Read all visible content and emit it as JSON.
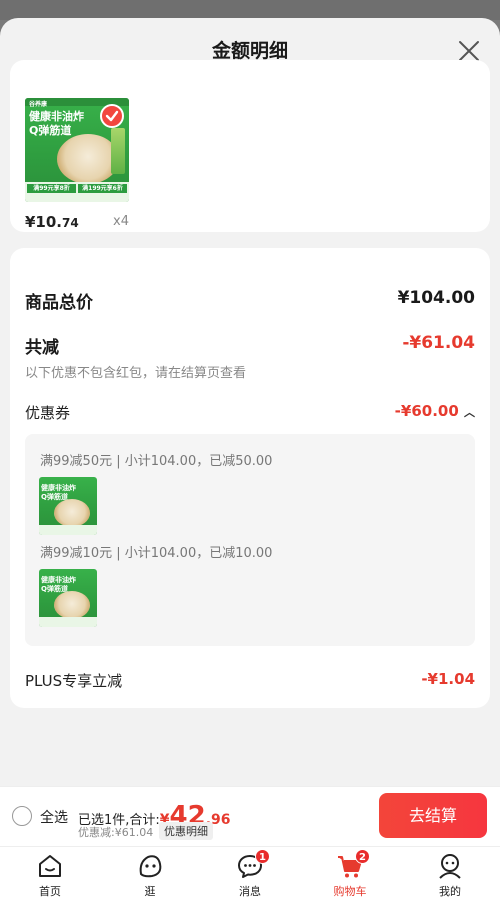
{
  "sheet": {
    "title": "金额明细"
  },
  "item": {
    "price_int": "¥10.",
    "price_dec": "74",
    "qty": "x4",
    "image": {
      "headline1": "健康非油炸",
      "headline2": "Q弹筋道",
      "brand": "谷养康",
      "promo1": "满99元享8折",
      "promo2": "满199元享6折"
    }
  },
  "summary": {
    "total_label": "商品总价",
    "total_value": "¥104.00",
    "discount_label": "共减",
    "discount_value": "-¥61.04",
    "note": "以下优惠不包含红包，请在结算页查看",
    "coupon_label": "优惠券",
    "coupon_value": "-¥60.00",
    "coupon_lines": [
      "满99减50元 | 小计104.00，已减50.00",
      "满99减10元 | 小计104.00，已减10.00"
    ],
    "plus_label": "PLUS专享立减",
    "plus_value": "-¥1.04"
  },
  "checkout": {
    "select_all": "全选",
    "summary_prefix": "已选1件,合计:",
    "total_cur": "¥",
    "total_int": "42",
    "total_dec": ".96",
    "saved": "优惠减:¥61.04",
    "detail_chip": "优惠明细",
    "button": "去结算"
  },
  "tabs": [
    {
      "label": "首页",
      "icon": "home-icon"
    },
    {
      "label": "逛",
      "icon": "face-icon"
    },
    {
      "label": "消息",
      "icon": "message-icon",
      "badge": "1"
    },
    {
      "label": "购物车",
      "icon": "cart-icon",
      "badge": "2",
      "active": true
    },
    {
      "label": "我的",
      "icon": "profile-icon"
    }
  ],
  "colors": {
    "accent": "#e63a2e",
    "green": "#38b14a"
  }
}
